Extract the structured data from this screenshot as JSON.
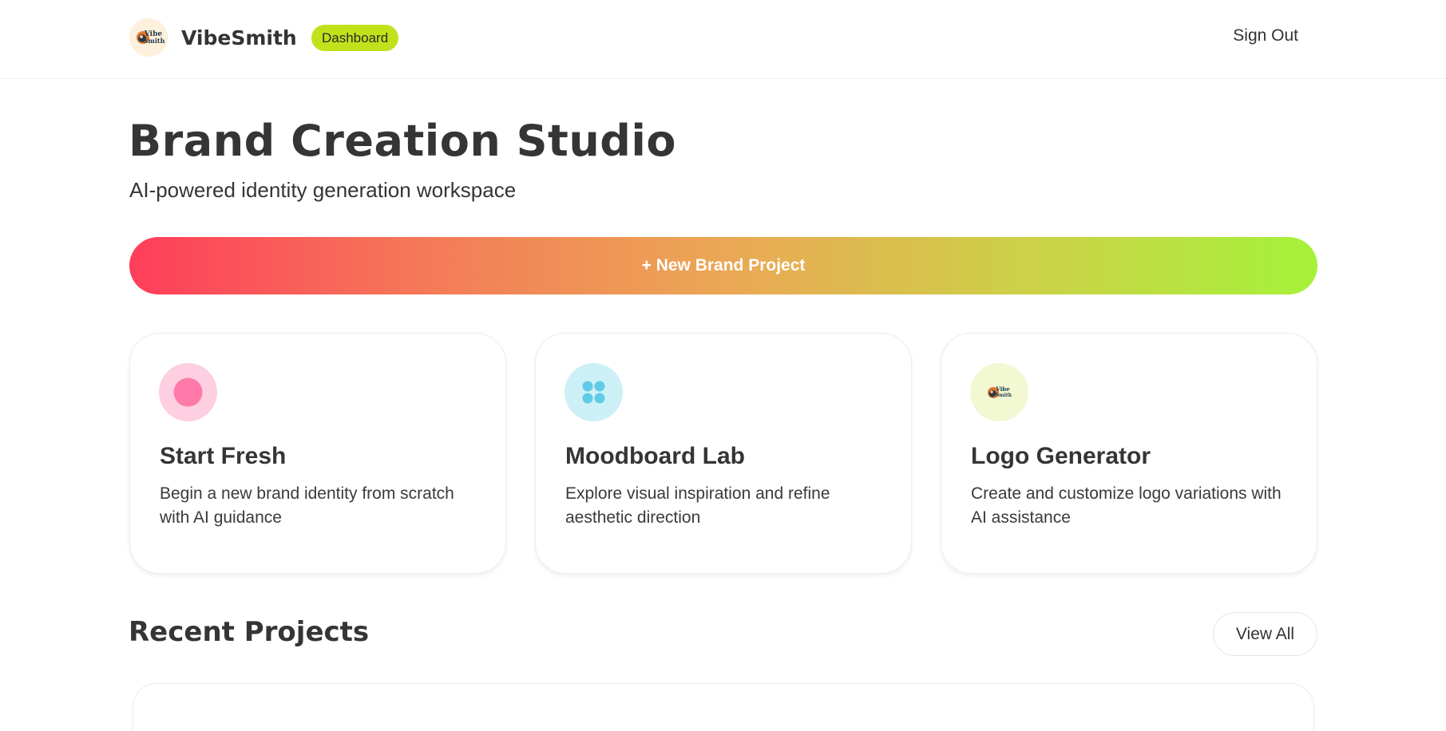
{
  "header": {
    "brand_name": "VibeSmith",
    "badge": "Dashboard",
    "sign_out": "Sign Out",
    "logo_text_line1": "Vibe",
    "logo_text_line2": "Smith"
  },
  "hero": {
    "title": "Brand Creation Studio",
    "subtitle": "AI-powered identity generation workspace",
    "cta_label": "+ New Brand Project"
  },
  "cards": [
    {
      "title": "Start Fresh",
      "description": "Begin a new brand identity from scratch with AI guidance",
      "icon": "circle-dot-icon",
      "icon_bg": "#fdcfe0",
      "icon_color": "#ff7aa8"
    },
    {
      "title": "Moodboard Lab",
      "description": "Explore visual inspiration and refine aesthetic direction",
      "icon": "grid-dots-icon",
      "icon_bg": "#cdf0f6",
      "icon_color": "#5fcbe6"
    },
    {
      "title": "Logo Generator",
      "description": "Create and customize logo variations with AI assistance",
      "icon": "vibesmith-logo-icon",
      "icon_bg": "#f1f8d2"
    }
  ],
  "recent": {
    "title": "Recent Projects",
    "view_all": "View All"
  },
  "colors": {
    "badge": "#c0e21a",
    "gradient_start": "#ff3d5b",
    "gradient_end": "#a6f23a",
    "text": "#353535"
  }
}
